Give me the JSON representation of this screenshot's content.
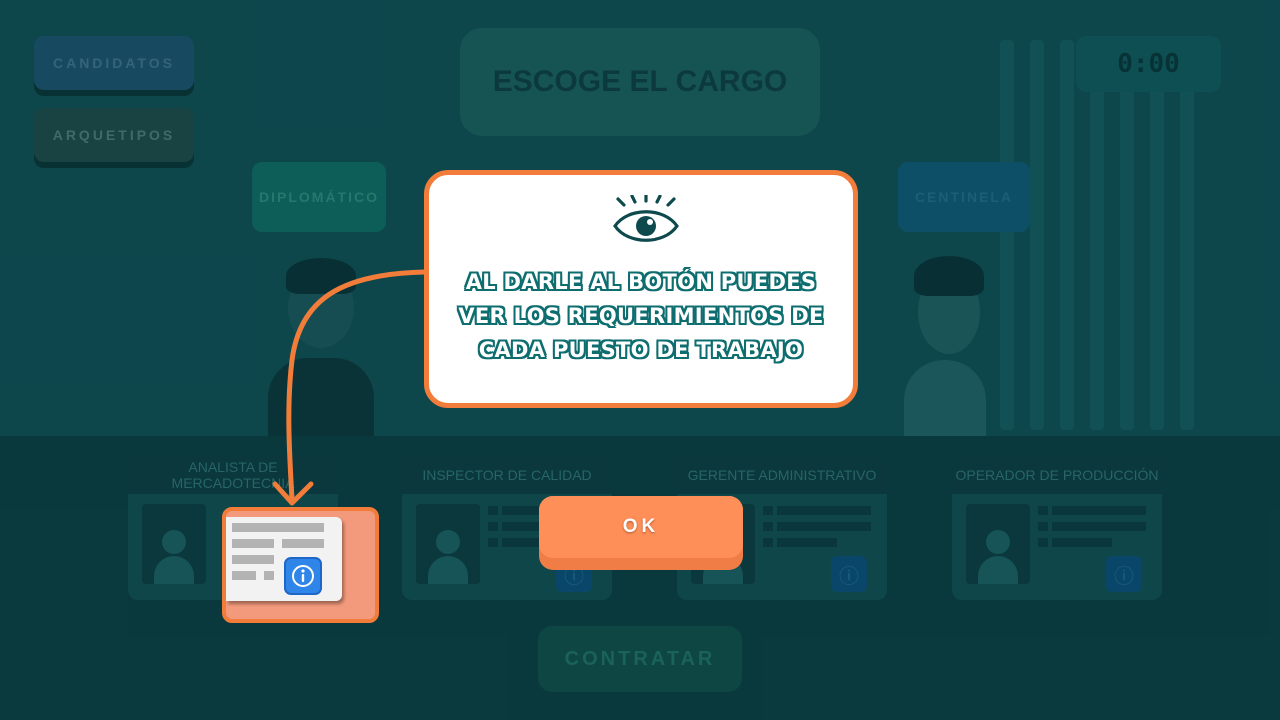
{
  "nav": {
    "candidatos_label": "CANDIDATOS",
    "arquetipos_label": "ARQUETIPOS"
  },
  "header": {
    "title": "ESCOGE EL CARGO",
    "timer": "0:00"
  },
  "archetypes": {
    "left_label": "DIPLOMÁTICO",
    "right_label": "CENTINELA"
  },
  "jobs": [
    {
      "title": "ANALISTA DE MERCADOTECNIA"
    },
    {
      "title": "INSPECTOR DE CALIDAD"
    },
    {
      "title": "GERENTE ADMINISTRATIVO"
    },
    {
      "title": "OPERADOR DE PRODUCCIÓN"
    }
  ],
  "actions": {
    "contratar_label": "CONTRATAR",
    "ok_label": "OK"
  },
  "tooltip": {
    "icon": "eye-icon",
    "text": "AL DARLE AL BOTÓN PUEDES\nVER LOS REQUERIMIENTOS DE\nCADA PUESTO DE TRABAJO"
  },
  "colors": {
    "accent": "#f27c3a",
    "teal_outline": "#0e6d6f",
    "info_button": "#2f86e8",
    "background": "#0e4449"
  }
}
